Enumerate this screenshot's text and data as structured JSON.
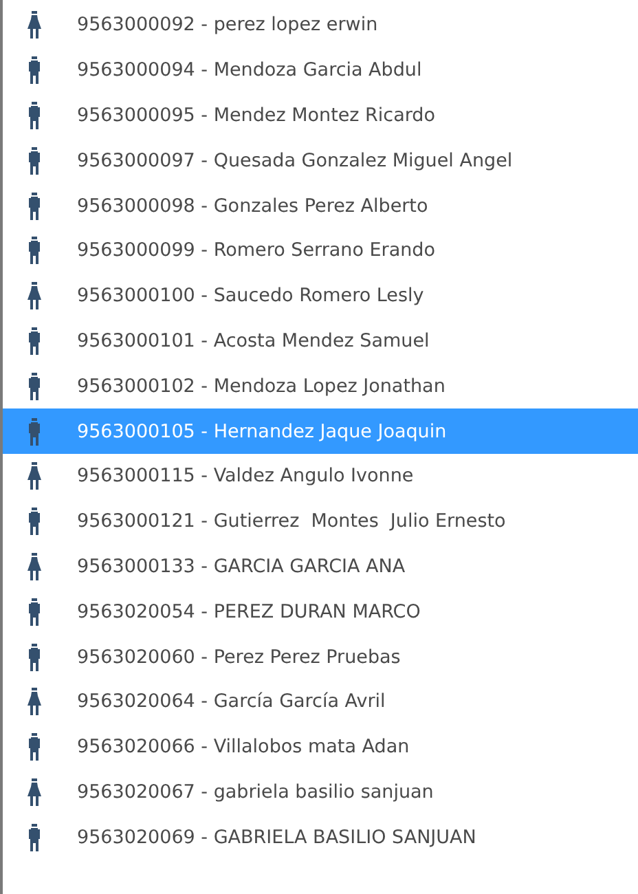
{
  "items": [
    {
      "kind": "female",
      "label": "9563000092 - perez lopez erwin",
      "selected": false
    },
    {
      "kind": "male",
      "label": "9563000094 - Mendoza Garcia Abdul",
      "selected": false
    },
    {
      "kind": "male",
      "label": "9563000095 - Mendez Montez Ricardo",
      "selected": false
    },
    {
      "kind": "male",
      "label": "9563000097 - Quesada Gonzalez Miguel Angel",
      "selected": false
    },
    {
      "kind": "male",
      "label": "9563000098 - Gonzales Perez Alberto",
      "selected": false
    },
    {
      "kind": "male",
      "label": "9563000099 - Romero Serrano Erando",
      "selected": false
    },
    {
      "kind": "female",
      "label": "9563000100 - Saucedo Romero Lesly",
      "selected": false
    },
    {
      "kind": "male",
      "label": "9563000101 - Acosta Mendez Samuel",
      "selected": false
    },
    {
      "kind": "male",
      "label": "9563000102 - Mendoza Lopez Jonathan",
      "selected": false
    },
    {
      "kind": "male",
      "label": "9563000105 - Hernandez Jaque Joaquin",
      "selected": true
    },
    {
      "kind": "female",
      "label": "9563000115 - Valdez Angulo Ivonne",
      "selected": false
    },
    {
      "kind": "male",
      "label": "9563000121 - Gutierrez  Montes  Julio Ernesto",
      "selected": false
    },
    {
      "kind": "female",
      "label": "9563000133 - GARCIA GARCIA ANA",
      "selected": false
    },
    {
      "kind": "male",
      "label": "9563020054 - PEREZ DURAN MARCO",
      "selected": false
    },
    {
      "kind": "male",
      "label": "9563020060 - Perez Perez Pruebas",
      "selected": false
    },
    {
      "kind": "female",
      "label": "9563020064 - García García Avril",
      "selected": false
    },
    {
      "kind": "male",
      "label": "9563020066 - Villalobos mata Adan",
      "selected": false
    },
    {
      "kind": "female",
      "label": "9563020067 - gabriela basilio sanjuan",
      "selected": false
    },
    {
      "kind": "male",
      "label": "9563020069 - GABRIELA BASILIO SANJUAN",
      "selected": false
    }
  ]
}
